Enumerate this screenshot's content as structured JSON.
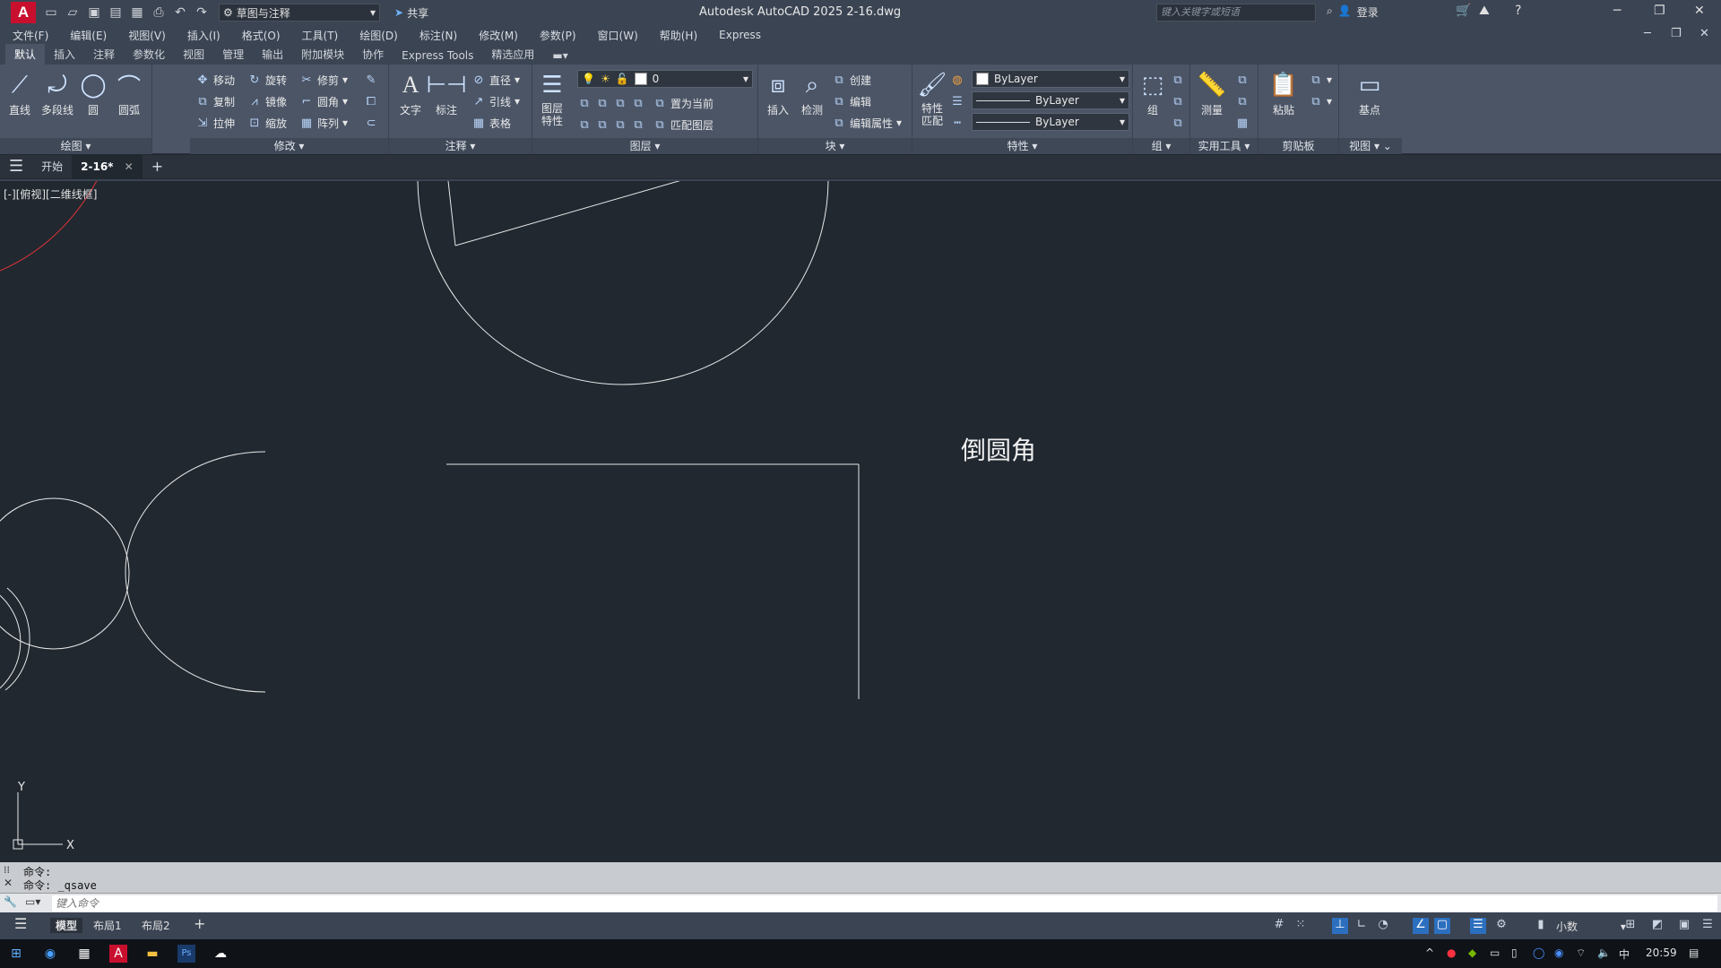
{
  "title_bar": {
    "app_logo": "A",
    "workspace": "草图与注释",
    "share_label": "共享",
    "title": "Autodesk AutoCAD 2025    2-16.dwg",
    "search_placeholder": "键入关键字或短语",
    "login_label": "登录"
  },
  "menu": [
    "文件(F)",
    "编辑(E)",
    "视图(V)",
    "插入(I)",
    "格式(O)",
    "工具(T)",
    "绘图(D)",
    "标注(N)",
    "修改(M)",
    "参数(P)",
    "窗口(W)",
    "帮助(H)",
    "Express"
  ],
  "ribbon_tabs": [
    "默认",
    "插入",
    "注释",
    "参数化",
    "视图",
    "管理",
    "输出",
    "附加模块",
    "协作",
    "Express Tools",
    "精选应用"
  ],
  "ribbon": {
    "draw": {
      "title": "绘图",
      "line": "直线",
      "polyline": "多段线",
      "circle": "圆",
      "arc": "圆弧"
    },
    "modify": {
      "title": "修改",
      "move": "移动",
      "rotate": "旋转",
      "trim": "修剪",
      "copy": "复制",
      "mirror": "镜像",
      "fillet": "圆角",
      "stretch": "拉伸",
      "scale": "缩放",
      "array": "阵列"
    },
    "annotation": {
      "title": "注释",
      "text": "文字",
      "dimension": "标注",
      "diameter": "直径",
      "leader": "引线",
      "table": "表格"
    },
    "layers": {
      "title": "图层",
      "layer_props": "图层\n特性",
      "current_layer": "0",
      "set_current": "置为当前",
      "match_layer": "匹配图层"
    },
    "block": {
      "title": "块",
      "insert": "插入",
      "inspect": "检测",
      "create": "创建",
      "edit": "编辑",
      "edit_attr": "编辑属性"
    },
    "properties": {
      "title": "特性",
      "match": "特性\n匹配",
      "color": "ByLayer",
      "linetype": "ByLayer",
      "lineweight": "ByLayer"
    },
    "group": {
      "title": "组",
      "group": "组"
    },
    "utilities": {
      "title": "实用工具",
      "measure": "测量"
    },
    "clipboard": {
      "title": "剪贴板",
      "paste": "粘贴"
    },
    "view": {
      "title": "视图",
      "base_point": "基点"
    }
  },
  "file_tabs": {
    "start": "开始",
    "current": "2-16*"
  },
  "drawing": {
    "view_label": "[-][俯视][二维线框]",
    "annotation_text": "倒圆角",
    "ucs_y": "Y",
    "ucs_x": "X"
  },
  "command": {
    "history": [
      "命令:",
      "命令: _qsave"
    ],
    "input_placeholder": "键入命令"
  },
  "layout_tabs": [
    "模型",
    "布局1",
    "布局2"
  ],
  "status": {
    "units": "小数"
  },
  "taskbar": {
    "ime": "中",
    "time": "20:59"
  }
}
